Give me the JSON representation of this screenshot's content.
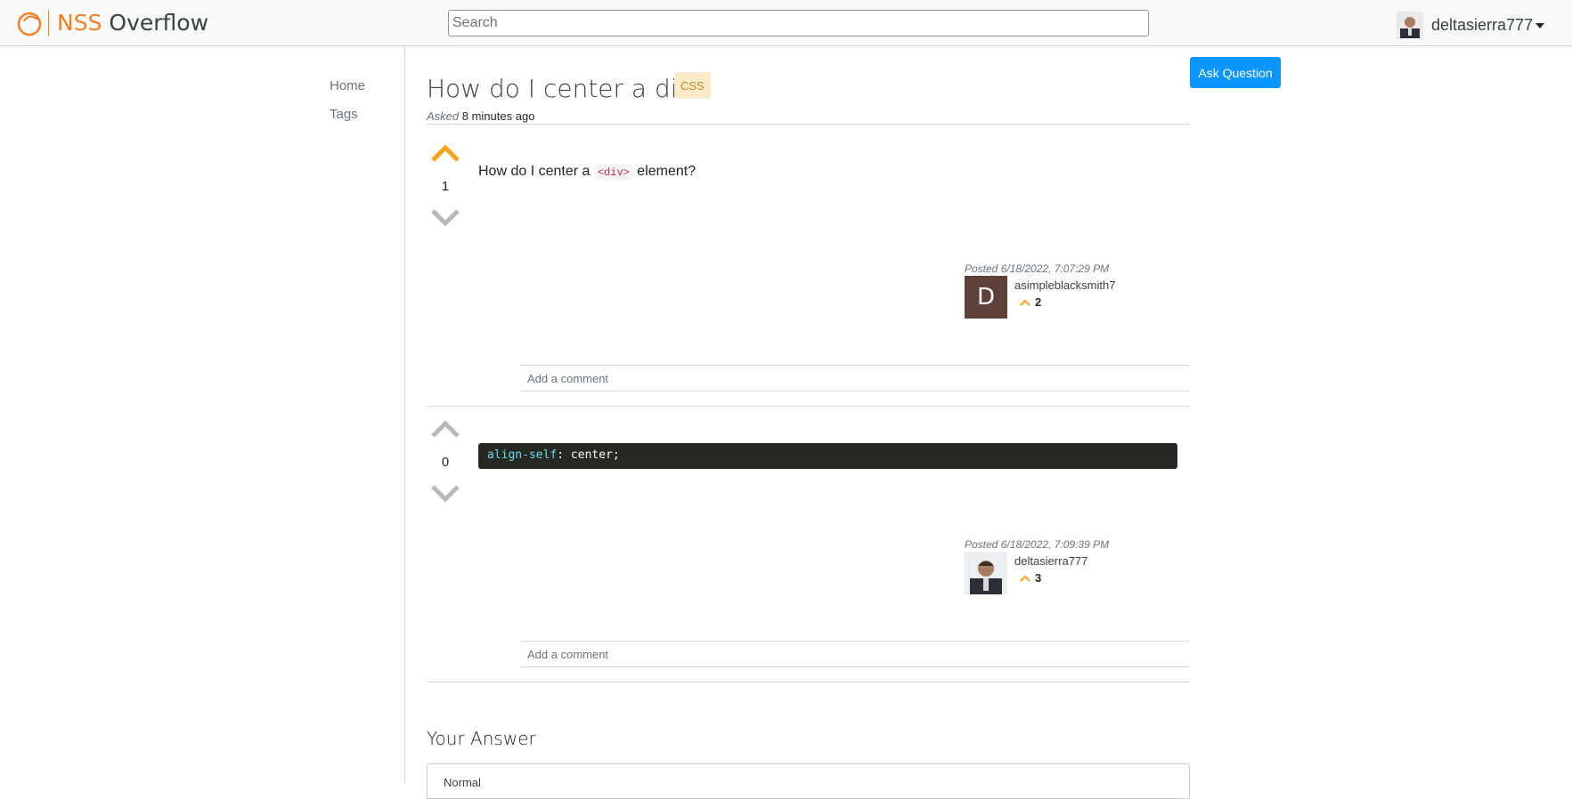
{
  "header": {
    "brand_prefix": "NSS",
    "brand_suffix": " Overflow",
    "search_placeholder": "Search",
    "username": "deltasierra777"
  },
  "sidebar": {
    "items": [
      {
        "label": "Home"
      },
      {
        "label": "Tags"
      }
    ]
  },
  "question": {
    "title": "How do I center a div?",
    "tag": "CSS",
    "asked_label": "Asked",
    "asked_time": "8 minutes ago",
    "ask_button": "Ask Question",
    "votes": "1",
    "body_before": "How do I center a ",
    "body_code": "<div>",
    "body_after": " element?",
    "posted": "Posted 6/18/2022, 7:07:29 PM",
    "author": {
      "initial": "D",
      "name": "asimpleblacksmith7",
      "reputation": "2"
    },
    "comment_placeholder": "Add a comment"
  },
  "answer": {
    "votes": "0",
    "code_property": "align-self",
    "code_rest": ": center;",
    "posted": "Posted 6/18/2022, 7:09:39 PM",
    "author": {
      "name": "deltasierra777",
      "reputation": "3"
    },
    "comment_placeholder": "Add a comment"
  },
  "your_answer": {
    "heading": "Your Answer",
    "editor_format": "Normal"
  },
  "colors": {
    "brand": "#f48024",
    "ask_button": "#0a95ff",
    "upvote_active": "#f7a21c",
    "vote_inactive": "#b8b8b8",
    "tag_bg": "#fdebc7",
    "code_bg": "#272822"
  },
  "icons": [
    "logo-icon",
    "upvote-icon",
    "downvote-icon",
    "caret-down-icon",
    "reputation-icon",
    "avatar"
  ]
}
